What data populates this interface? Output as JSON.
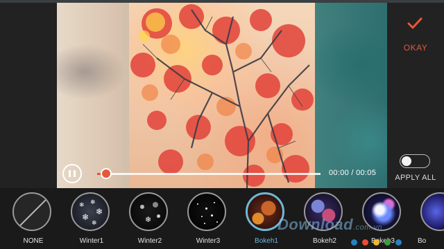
{
  "player": {
    "progress": 0.04,
    "time": "00:00 / 00:05",
    "pause_icon": "pause-icon"
  },
  "actions": {
    "okay_label": "OKAY",
    "okay_icon": "checkmark-icon",
    "apply_all_label": "APPLY ALL",
    "apply_all_on": false
  },
  "filters": [
    {
      "label": "NONE",
      "icon": "none-slash-icon"
    },
    {
      "label": "Winter1",
      "icon": "snowflake-icon"
    },
    {
      "label": "Winter2",
      "icon": "snowflake-icon"
    },
    {
      "label": "Winter3",
      "icon": "snow-dots-icon"
    },
    {
      "label": "Bokeh1",
      "icon": "bokeh-icon",
      "selected": true
    },
    {
      "label": "Bokeh2",
      "icon": "bokeh-icon"
    },
    {
      "label": "Bokeh3",
      "icon": "bokeh-icon"
    },
    {
      "label": "Bo",
      "icon": "bokeh-icon"
    }
  ],
  "watermark": {
    "text": "Download",
    "suffix": ".com.vn",
    "dot_colors": [
      "#2a7fc1",
      "#e94d3a",
      "#f1b72a",
      "#3b9b3f",
      "#2a7fc1"
    ]
  },
  "colors": {
    "accent": "#e5583b",
    "selected": "#6fb9d6"
  }
}
